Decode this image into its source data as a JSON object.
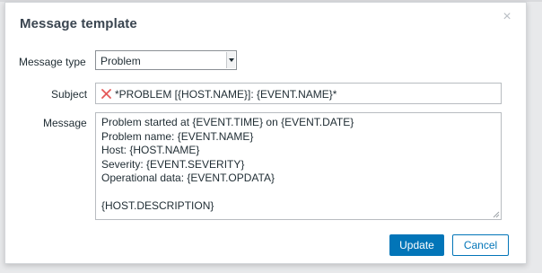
{
  "dialog": {
    "title": "Message template"
  },
  "form": {
    "message_type": {
      "label": "Message type",
      "value": "Problem"
    },
    "subject": {
      "label": "Subject",
      "value": "*PROBLEM [{HOST.NAME}]: {EVENT.NAME}*"
    },
    "message": {
      "label": "Message",
      "lines": [
        "Problem started at {EVENT.TIME} on {EVENT.DATE}",
        "Problem name: {EVENT.NAME}",
        "Host: {HOST.NAME}",
        "Severity: {EVENT.SEVERITY}",
        "Operational data: {EVENT.OPDATA}",
        "",
        "{HOST.DESCRIPTION}"
      ]
    }
  },
  "buttons": {
    "update": "Update",
    "cancel": "Cancel"
  },
  "colors": {
    "primary": "#0275b8",
    "error": "#e45959"
  },
  "icons": {
    "close": "close-icon",
    "error": "error-cross-icon",
    "dropdown": "chevron-down-icon",
    "resize": "resize-grip-icon"
  }
}
